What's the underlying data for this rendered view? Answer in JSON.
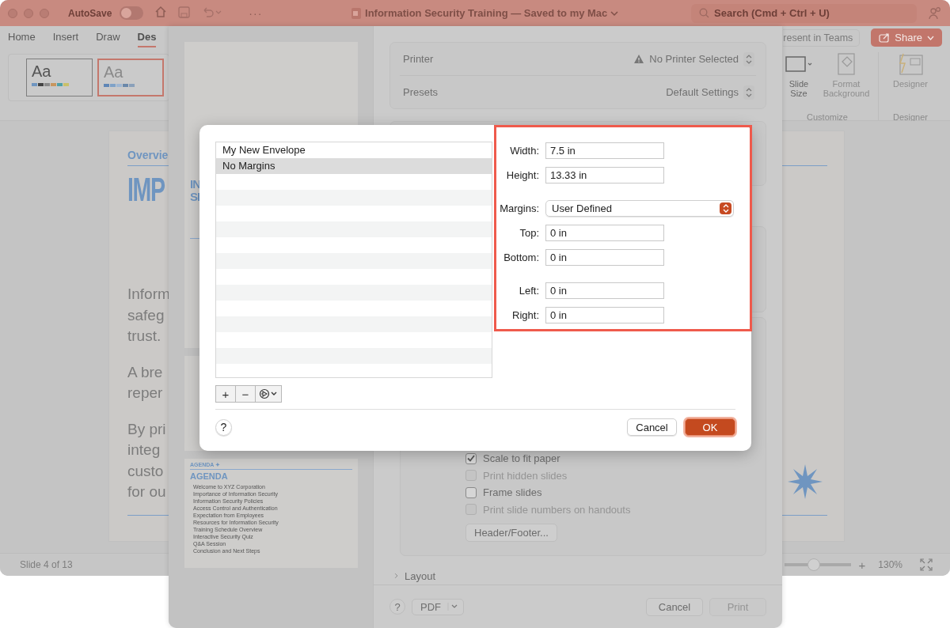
{
  "app_window": {
    "title_bar": {
      "autosave_label": "AutoSave",
      "autosave_on": false,
      "more": "···",
      "title": "Information Security Training — Saved to my Mac",
      "search_placeholder": "Search (Cmd + Ctrl + U)"
    },
    "ribbon_tabs": [
      {
        "label": "Home",
        "selected": false
      },
      {
        "label": "Insert",
        "selected": false
      },
      {
        "label": "Draw",
        "selected": false
      },
      {
        "label": "Des",
        "selected": true
      }
    ],
    "theme_thumbnails": [
      {
        "label": "Aa",
        "selected": false
      },
      {
        "label": "Aa",
        "selected": true
      }
    ],
    "present_button": "resent in Teams",
    "share_button": "Share",
    "ribbon_commands": [
      {
        "label": "Slide Size"
      },
      {
        "label": "Format Background"
      },
      {
        "label": "Designer"
      }
    ],
    "group_labels": [
      "Customize",
      "Designer"
    ],
    "slide": {
      "section": "Overvie",
      "heading": "IMP",
      "paragraphs": [
        "Inform\nsafeg\ntrust.",
        "A bre\nreper",
        "By pri\ninteg\ncusto\nfor ou"
      ]
    },
    "status_bar": {
      "slide_counter": "Slide 4 of 13",
      "zoom_slider": {
        "level": 0.45
      },
      "zoom_plus": "+",
      "zoom_percent": "130%"
    }
  },
  "print_sheet": {
    "thumbnails": [
      {
        "kind": "title",
        "lines": [
          "IN",
          "SI"
        ]
      },
      {
        "kind": "blank"
      },
      {
        "kind": "agenda",
        "eyebrow": "AGENDA ✦",
        "heading": "AGENDA",
        "items": [
          "Welcome to XYZ Corporation",
          "Importance of Information Security",
          "Information Security Policies",
          "Access Control and Authentication",
          "Expectation from Employees",
          "Resources for Information Security",
          "Training Schedule Overview",
          "Interactive Security Quiz",
          "Q&A Session",
          "Conclusion and Next Steps"
        ]
      }
    ],
    "printer": {
      "label": "Printer",
      "value": "No Printer Selected"
    },
    "presets": {
      "label": "Presets",
      "value": "Default Settings"
    },
    "options": [
      {
        "label": "Scale to fit paper",
        "checked": true,
        "disabled": false
      },
      {
        "label": "Print hidden slides",
        "checked": false,
        "disabled": true
      },
      {
        "label": "Frame slides",
        "checked": false,
        "disabled": false
      },
      {
        "label": "Print slide numbers on handouts",
        "checked": false,
        "disabled": true
      }
    ],
    "header_footer_button": "Header/Footer...",
    "layout_section": {
      "label": "Layout",
      "expanded": false
    },
    "footer": {
      "help": "?",
      "pdf": "PDF",
      "cancel": "Cancel",
      "print": {
        "label": "Print",
        "disabled": true
      }
    }
  },
  "page_setup": {
    "paper_sizes": [
      {
        "label": "My New Envelope",
        "selected": false
      },
      {
        "label": "No Margins",
        "selected": true
      }
    ],
    "list_buttons": [
      "+",
      "−"
    ],
    "field_groups": [
      {
        "fields": [
          {
            "kind": "field",
            "label": "Width:",
            "value": "7.5 in"
          },
          {
            "kind": "field",
            "label": "Height:",
            "value": "13.33 in"
          }
        ]
      },
      {
        "fields": [
          {
            "kind": "popup",
            "label": "Margins:",
            "value": "User Defined"
          },
          {
            "kind": "field",
            "label": "Top:",
            "value": "0 in"
          },
          {
            "kind": "field",
            "label": "Bottom:",
            "value": "0 in"
          }
        ]
      },
      {
        "fields": [
          {
            "kind": "field",
            "label": "Left:",
            "value": "0 in"
          },
          {
            "kind": "field",
            "label": "Right:",
            "value": "0 in"
          }
        ]
      }
    ],
    "help": "?",
    "cancel": "Cancel",
    "ok": "OK"
  }
}
